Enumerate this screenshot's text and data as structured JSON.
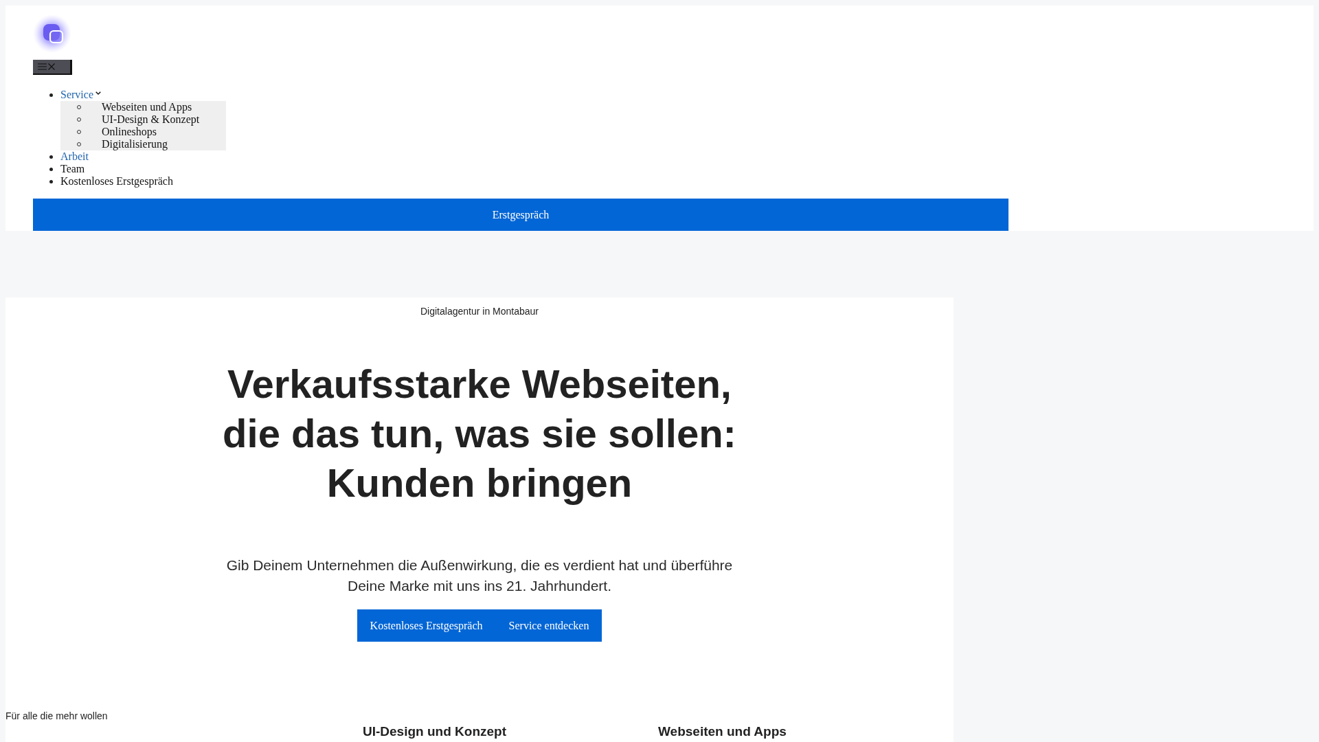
{
  "header": {
    "nav": [
      {
        "label": "Service",
        "kind": "link",
        "children": [
          {
            "label": "Webseiten und Apps"
          },
          {
            "label": "UI-Design & Konzept"
          },
          {
            "label": "Onlineshops"
          },
          {
            "label": "Digitalisierung"
          }
        ]
      },
      {
        "label": "Arbeit",
        "kind": "link"
      },
      {
        "label": "Team",
        "kind": "text"
      },
      {
        "label": "Kostenloses Erstgespräch",
        "kind": "text"
      }
    ],
    "cta_button": "Erstgespräch"
  },
  "hero": {
    "eyebrow": "Digitalagentur in Montabaur",
    "heading": "Verkaufsstarke Webseiten, die das tun, was sie sollen: Kunden bringen",
    "text": "Gib Deinem Unternehmen die Außenwirkung, die es verdient hat und überführe Deine Marke mit uns ins 21. Jahrhundert.",
    "buttons": [
      "Kostenloses Erstgespräch",
      "Service entdecken"
    ]
  },
  "services": {
    "kicker": "Für alle die mehr wollen",
    "items": [
      {
        "title": "UI-Design und Konzept"
      },
      {
        "title": "Webseiten und Apps"
      }
    ]
  }
}
